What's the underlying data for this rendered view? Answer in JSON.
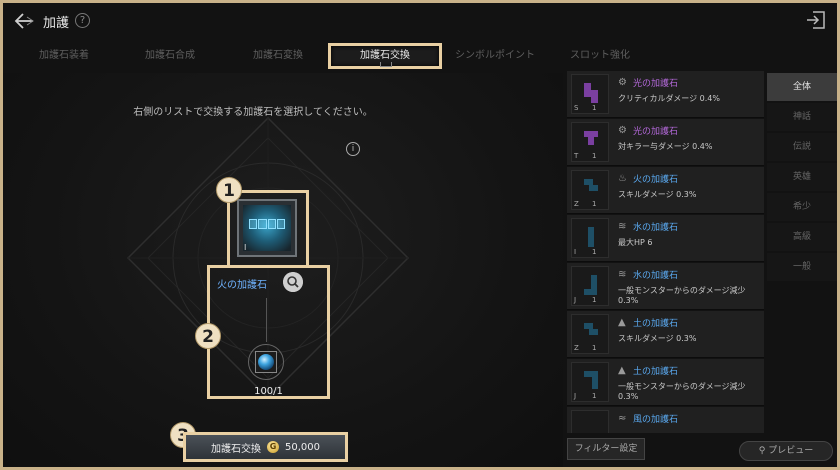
{
  "header": {
    "title": "加護"
  },
  "tabs": [
    {
      "label": "加護石装着"
    },
    {
      "label": "加護石合成"
    },
    {
      "label": "加護石変換"
    },
    {
      "label": "加護石交換"
    },
    {
      "label": "シンボルポイント"
    },
    {
      "label": "スロット強化"
    }
  ],
  "active_tab": "加護石交換",
  "main": {
    "instruction": "右側のリストで交換する加護石を選択してください。",
    "selected_stone": {
      "grade": "I",
      "name": "火の加護石"
    },
    "material": {
      "count": "100/1"
    },
    "exchange_button": {
      "label": "加護石交換",
      "currency_icon": "gold-coin-icon",
      "currency_letter": "G",
      "cost": "50,000"
    },
    "badges": [
      "1",
      "2",
      "3"
    ]
  },
  "list": [
    {
      "thumb_left": "S",
      "thumb_right": "1",
      "element_icon": "light-icon",
      "name": "光の加護石",
      "stat": "クリティカルダメージ 0.4%",
      "color": "#b368d9"
    },
    {
      "thumb_left": "T",
      "thumb_right": "1",
      "element_icon": "light-icon",
      "name": "光の加護石",
      "stat": "対キラー与ダメージ 0.4%",
      "color": "#b368d9"
    },
    {
      "thumb_left": "Z",
      "thumb_right": "1",
      "element_icon": "fire-icon",
      "name": "火の加護石",
      "stat": "スキルダメージ 0.3%",
      "color": "#5aa9f0"
    },
    {
      "thumb_left": "I",
      "thumb_right": "1",
      "element_icon": "water-icon",
      "name": "水の加護石",
      "stat": "最大HP 6",
      "color": "#5aa9f0"
    },
    {
      "thumb_left": "J",
      "thumb_right": "1",
      "element_icon": "water-icon",
      "name": "水の加護石",
      "stat": "一般モンスターからのダメージ減少 0.3%",
      "color": "#5aa9f0"
    },
    {
      "thumb_left": "Z",
      "thumb_right": "1",
      "element_icon": "earth-icon",
      "name": "土の加護石",
      "stat": "スキルダメージ 0.3%",
      "color": "#5aa9f0"
    },
    {
      "thumb_left": "J",
      "thumb_right": "1",
      "element_icon": "earth-icon",
      "name": "土の加護石",
      "stat": "一般モンスターからのダメージ減少 0.3%",
      "color": "#5aa9f0"
    },
    {
      "thumb_left": "",
      "thumb_right": "",
      "element_icon": "wind-icon",
      "name": "風の加護石",
      "stat": "",
      "color": "#5aa9f0"
    }
  ],
  "filters": [
    "全体",
    "神話",
    "伝説",
    "英雄",
    "希少",
    "高級",
    "一般"
  ],
  "active_filter": "全体",
  "footer": {
    "filter_settings": "フィルター設定",
    "preview": "プレビュー"
  },
  "colors": {
    "accent_border": "#e9d0a3",
    "light_stone": "#b368d9",
    "stone_blue": "#5aa9f0"
  }
}
